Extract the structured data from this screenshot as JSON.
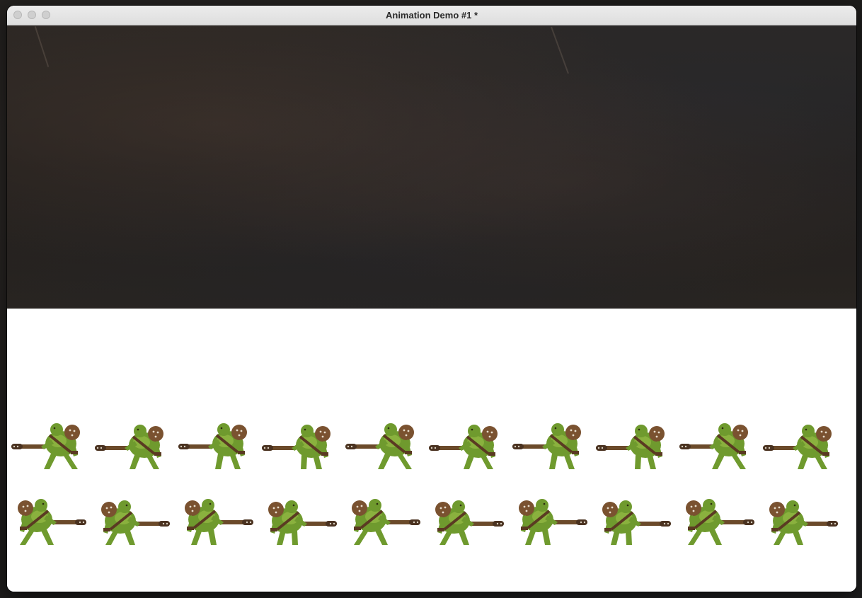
{
  "window": {
    "title": "Animation Demo #1 *"
  },
  "scene": {
    "top_panel": "textured-dark-stone-background",
    "bottom_panel": "white-background",
    "sprite_rows": [
      {
        "name": "orc-walk-left",
        "frame_count": 10,
        "facing": "left"
      },
      {
        "name": "orc-walk-right",
        "frame_count": 10,
        "facing": "right"
      }
    ]
  },
  "colors": {
    "orc_skin": "#6f9a2e",
    "orc_skin_light": "#9cc24a",
    "club": "#6b4a2a",
    "stone_dark": "#231f1d"
  }
}
